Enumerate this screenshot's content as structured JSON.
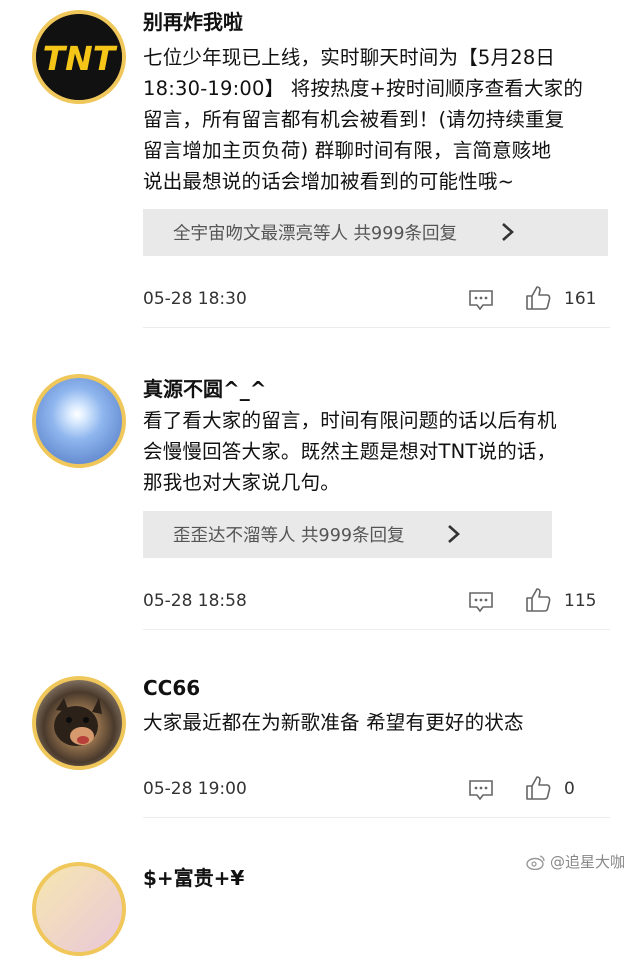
{
  "comments": [
    {
      "username": "别再炸我啦",
      "lines": [
        "七位少年现已上线，实时聊天时间为【5月28日",
        "18:30-19:00】 将按热度+按时间顺序查看大家的",
        "留言，所有留言都有机会被看到！(请勿持续重复",
        "留言增加主页负荷) 群聊时间有限，言简意赅地",
        "说出最想说的话会增加被看到的可能性哦~"
      ],
      "avatar_text": "TNT",
      "replies": "全宇宙吻文最漂亮等人 共999条回复",
      "time": "05-28 18:30",
      "likes": "161"
    },
    {
      "username": "真源不圆^_^",
      "lines": [
        "看了看大家的留言，时间有限问题的话以后有机",
        "会慢慢回答大家。既然主题是想对TNT说的话，",
        "那我也对大家说几句。"
      ],
      "replies": "歪歪达不溜等人 共999条回复",
      "time": "05-28 18:58",
      "likes": "115"
    },
    {
      "username": "CC66",
      "lines": [
        "大家最近都在为新歌准备 希望有更好的状态"
      ],
      "time": "05-28 19:00",
      "likes": "0"
    },
    {
      "username": "$+富贵+¥"
    }
  ],
  "watermark": "@追星大咖",
  "colors": {
    "avatar_ring": "#f0c75a",
    "tnt_yellow": "#f5c518",
    "reply_bg": "#e9e9e9"
  }
}
